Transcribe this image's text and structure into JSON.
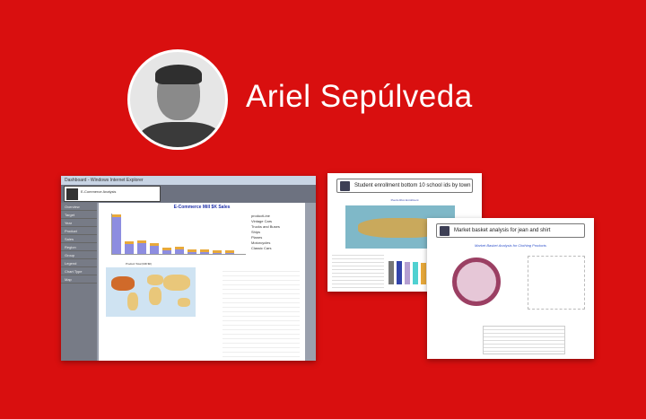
{
  "author": {
    "name": "Ariel Sepúlveda"
  },
  "dashboard": {
    "window_title": "Dashboard - Windows Internet Explorer",
    "search_text": "E-Commerce Analysis",
    "chart_title": "E-Commerce Mill $K Sales",
    "legend_title": "productLine",
    "legend": [
      "Vintage Cars",
      "Trucks and Buses",
      "Ships",
      "Planes",
      "Motorcycles",
      "Classic Cars"
    ],
    "side_items": [
      "Overview",
      "Target",
      "Year",
      "Product",
      "Sales",
      "Region",
      "Group",
      "Legend",
      "Chart Type",
      "Map"
    ],
    "map_title": "Product Total (Mill $K)"
  },
  "card2": {
    "title": "Student enrollment bottom 10 school ids by town",
    "map_title": "Puerto Rico Enrollment"
  },
  "card3": {
    "title": "Market basket analysis for jean and shirt",
    "chart_title": "Market Basket Analysis for Clothing Products"
  },
  "colors": {
    "background": "#d90f0f"
  }
}
